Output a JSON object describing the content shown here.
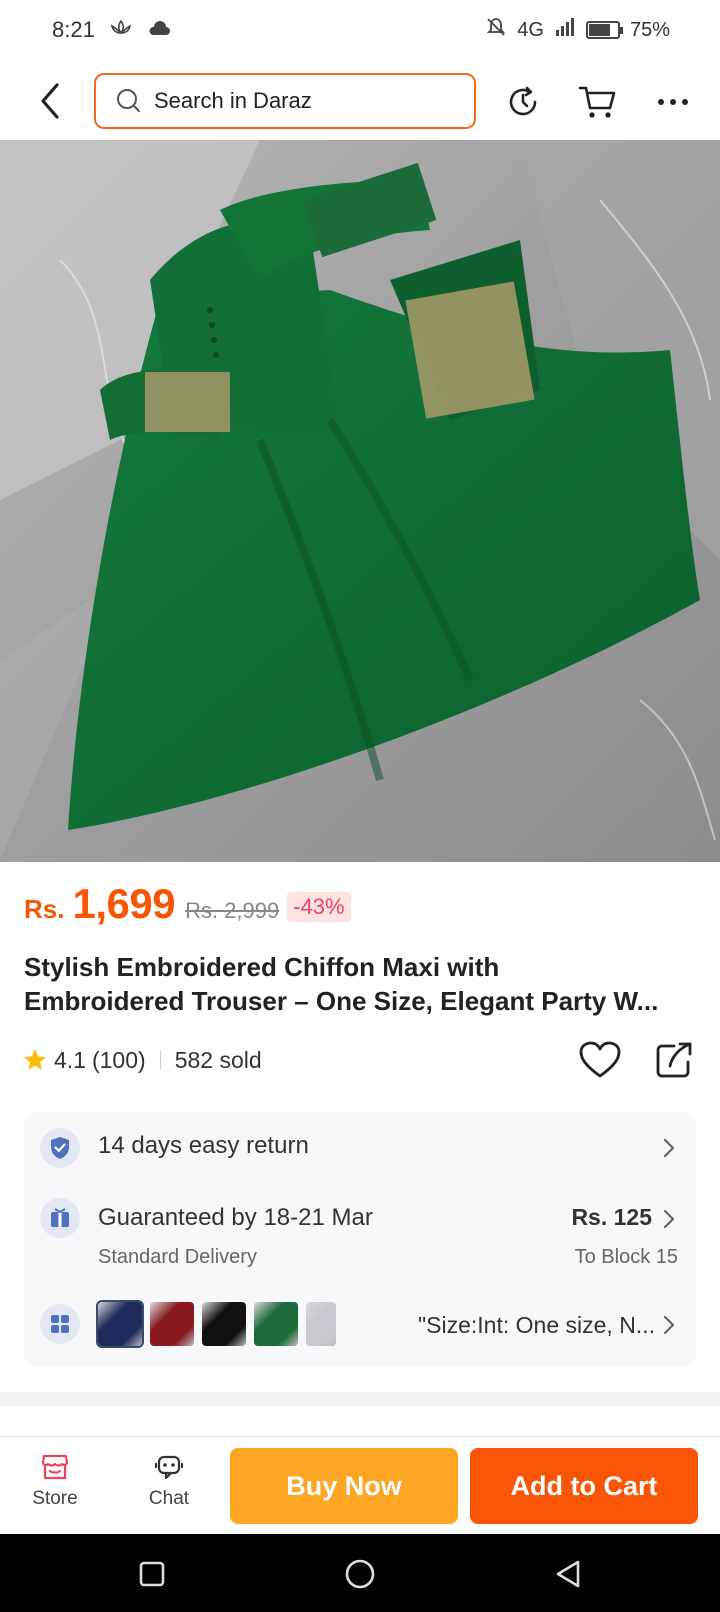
{
  "status_bar": {
    "time": "8:21",
    "network": "4G",
    "battery_percent": "75%",
    "battery_level": 0.75
  },
  "header": {
    "search_placeholder": "Search in Daraz",
    "icons": [
      "back-icon",
      "search-icon",
      "history-icon",
      "cart-icon",
      "more-icon"
    ]
  },
  "product": {
    "image_alt": "Green embroidered chiffon maxi dress",
    "currency": "Rs.",
    "price": "1,699",
    "original_price": "Rs. 2,999",
    "discount": "-43%",
    "title_line1": "Stylish Embroidered Chiffon Maxi with",
    "title_line2": "Embroidered Trouser – One Size, Elegant Party W...",
    "rating": "4.1",
    "reviews": "(100)",
    "sold": "582 sold"
  },
  "info": {
    "return_text": "14 days easy return",
    "delivery_main": "Guaranteed by 18-21 Mar",
    "delivery_sub": "Standard Delivery",
    "delivery_fee": "Rs. 125",
    "delivery_to": "To Block 15",
    "variant_text": "\"Size:Int: One size, N...",
    "swatch_colors": [
      "#1f2a5c",
      "#8a1a22",
      "#111111",
      "#1d6b3a",
      "#c8c8d0"
    ]
  },
  "bottom_bar": {
    "store_label": "Store",
    "chat_label": "Chat",
    "buy_now_label": "Buy Now",
    "add_to_cart_label": "Add to Cart"
  },
  "colors": {
    "brand_orange": "#f85606",
    "buy_now_yellow": "#fca623",
    "accent_pink": "#f0435a"
  }
}
